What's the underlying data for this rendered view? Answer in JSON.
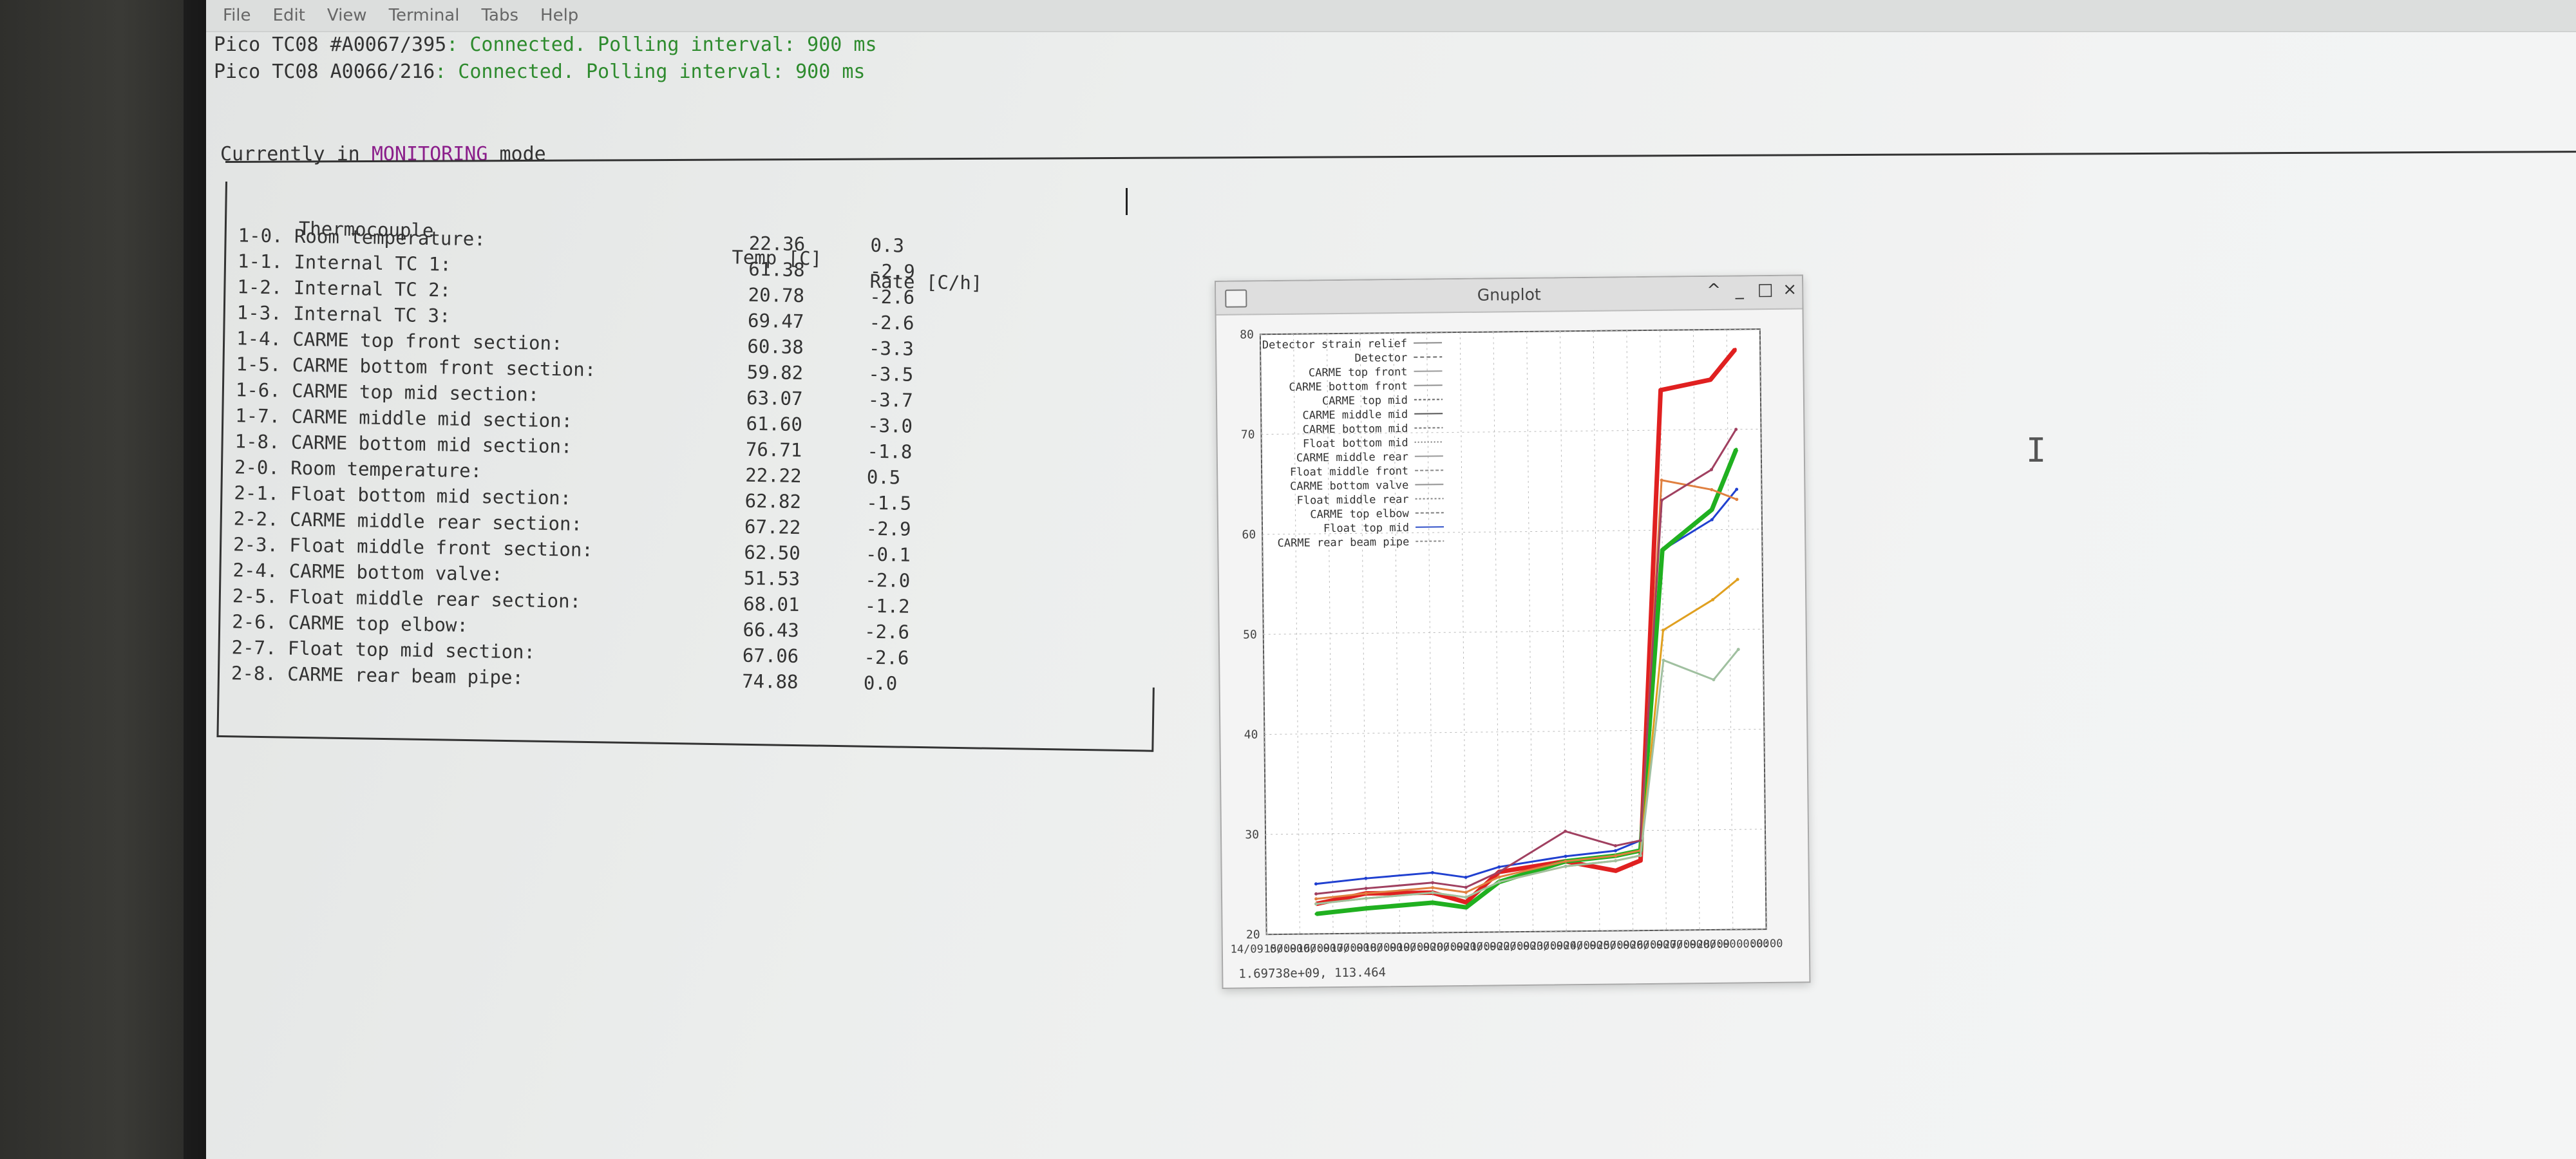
{
  "menubar": {
    "items": [
      "File",
      "Edit",
      "View",
      "Terminal",
      "Tabs",
      "Help"
    ]
  },
  "log": [
    {
      "device": "Pico TC08 #A0067/395",
      "message": ": Connected. Polling interval: 900 ms"
    },
    {
      "device": "Pico TC08 A0066/216",
      "message": ": Connected. Polling interval: 900 ms"
    }
  ],
  "mode": {
    "prefix": "Currently in ",
    "value": "MONITORING",
    "suffix": " mode"
  },
  "table": {
    "headers": {
      "name": "Thermocouple",
      "temp": "Temp [C]",
      "rate": "Rate [C/h]"
    },
    "rows": [
      {
        "name": "1-0. Room temperature:",
        "temp": "22.36",
        "rate": "0.3"
      },
      {
        "name": "1-1. Internal TC 1:",
        "temp": "61.38",
        "rate": "-2.9"
      },
      {
        "name": "1-2. Internal TC 2:",
        "temp": "20.78",
        "rate": "-2.6"
      },
      {
        "name": "1-3. Internal TC 3:",
        "temp": "69.47",
        "rate": "-2.6"
      },
      {
        "name": "1-4. CARME top front section:",
        "temp": "60.38",
        "rate": "-3.3"
      },
      {
        "name": "1-5. CARME bottom front section:",
        "temp": "59.82",
        "rate": "-3.5"
      },
      {
        "name": "1-6. CARME top mid section:",
        "temp": "63.07",
        "rate": "-3.7"
      },
      {
        "name": "1-7. CARME middle mid section:",
        "temp": "61.60",
        "rate": "-3.0"
      },
      {
        "name": "1-8. CARME bottom mid section:",
        "temp": "76.71",
        "rate": "-1.8"
      },
      {
        "name": "2-0. Room temperature:",
        "temp": "22.22",
        "rate": "0.5"
      },
      {
        "name": "2-1. Float bottom mid section:",
        "temp": "62.82",
        "rate": "-1.5"
      },
      {
        "name": "2-2. CARME middle rear section:",
        "temp": "67.22",
        "rate": "-2.9"
      },
      {
        "name": "2-3. Float middle front section:",
        "temp": "62.50",
        "rate": "-0.1"
      },
      {
        "name": "2-4. CARME bottom valve:",
        "temp": "51.53",
        "rate": "-2.0"
      },
      {
        "name": "2-5. Float middle rear section:",
        "temp": "68.01",
        "rate": "-1.2"
      },
      {
        "name": "2-6. CARME top elbow:",
        "temp": "66.43",
        "rate": "-2.6"
      },
      {
        "name": "2-7. Float top mid section:",
        "temp": "67.06",
        "rate": "-2.6"
      },
      {
        "name": "2-8. CARME rear beam pipe:",
        "temp": "74.88",
        "rate": "0.0"
      }
    ]
  },
  "gnuplot": {
    "title": "Gnuplot",
    "controls": {
      "up": "^",
      "minimize": "_",
      "maximize": "□",
      "close": "×"
    },
    "status": "1.69738e+09,  113.464",
    "y_ticks": [
      "20",
      "30",
      "40",
      "50",
      "60",
      "70",
      "80"
    ],
    "x_ticks": [
      "14/09 00:00",
      "15/09 00:00",
      "16/09 00:00",
      "17/09 00:00",
      "18/09 00:00",
      "19/09 00:00",
      "20/09 00:00",
      "21/09 00:00",
      "22/09 00:00",
      "23/09 00:00",
      "24/09 00:00",
      "25/09 00:00",
      "26/09 00:00",
      "27/09 00:00",
      "28/09 00:00",
      "00:00"
    ],
    "legend": [
      {
        "name": "Detector strain relief",
        "color": "#8a8a8a",
        "dash": ""
      },
      {
        "name": "Detector",
        "color": "#6a6a6a",
        "dash": "6,4"
      },
      {
        "name": "CARME top front",
        "color": "#9a9a9a",
        "dash": ""
      },
      {
        "name": "CARME bottom front",
        "color": "#8e8e8e",
        "dash": ""
      },
      {
        "name": "CARME top mid",
        "color": "#666666",
        "dash": "4,3"
      },
      {
        "name": "CARME middle mid",
        "color": "#555555",
        "dash": ""
      },
      {
        "name": "CARME bottom mid",
        "color": "#777777",
        "dash": "4,3"
      },
      {
        "name": "Float bottom mid",
        "color": "#7a7a7a",
        "dash": "2,3"
      },
      {
        "name": "CARME middle rear",
        "color": "#999999",
        "dash": ""
      },
      {
        "name": "Float middle front",
        "color": "#888888",
        "dash": "5,3"
      },
      {
        "name": "CARME bottom valve",
        "color": "#909090",
        "dash": ""
      },
      {
        "name": "Float middle rear",
        "color": "#858585",
        "dash": "3,3"
      },
      {
        "name": "CARME top elbow",
        "color": "#7d7d7d",
        "dash": "5,3"
      },
      {
        "name": "Float top mid",
        "color": "#3050c8",
        "dash": ""
      },
      {
        "name": "CARME rear beam pipe",
        "color": "#8a8a8a",
        "dash": "4,3"
      }
    ]
  },
  "chart_data": {
    "type": "line",
    "ylim": [
      20,
      80
    ],
    "xlim": [
      "14/09 00:00",
      "29/09 00:00"
    ],
    "x_ticks": [
      "14/09 00:00",
      "15/09 00:00",
      "16/09 00:00",
      "17/09 00:00",
      "18/09 00:00",
      "19/09 00:00",
      "20/09 00:00",
      "21/09 00:00",
      "22/09 00:00",
      "23/09 00:00",
      "24/09 00:00",
      "25/09 00:00",
      "26/09 00:00",
      "27/09 00:00",
      "28/09 00:00",
      "29/09 00:00"
    ],
    "grid": true,
    "legend_position": "top-left",
    "series": [
      {
        "name": "CARME rear beam pipe",
        "color": "#e02020",
        "x": [
          "15/09 12:00",
          "17/09 00:00",
          "19/09 00:00",
          "20/09 00:00",
          "21/09 00:00",
          "23/09 00:00",
          "24/09 12:00",
          "25/09 06:00",
          "26/09 00:00",
          "27/09 12:00",
          "28/09 06:00"
        ],
        "values": [
          23,
          24,
          24,
          23,
          26,
          27,
          26,
          27,
          74,
          75,
          78
        ]
      },
      {
        "name": "Float top mid",
        "color": "#2040d0",
        "x": [
          "15/09 12:00",
          "17/09 00:00",
          "19/09 00:00",
          "20/09 00:00",
          "21/09 00:00",
          "23/09 00:00",
          "24/09 12:00",
          "25/09 06:00",
          "26/09 00:00",
          "27/09 12:00",
          "28/09 06:00"
        ],
        "values": [
          25,
          25.5,
          26,
          25.5,
          26.5,
          27.5,
          28,
          29,
          58,
          61,
          64
        ]
      },
      {
        "name": "CARME top elbow",
        "color": "#20b020",
        "x": [
          "15/09 12:00",
          "17/09 00:00",
          "19/09 00:00",
          "20/09 00:00",
          "21/09 00:00",
          "23/09 00:00",
          "24/09 12:00",
          "25/09 06:00",
          "26/09 00:00",
          "27/09 12:00",
          "28/09 06:00"
        ],
        "values": [
          22,
          22.5,
          23,
          22.5,
          25,
          27,
          27.5,
          28,
          58,
          62,
          68
        ]
      },
      {
        "name": "Float middle rear",
        "color": "#e08040",
        "x": [
          "15/09 12:00",
          "17/09 00:00",
          "19/09 00:00",
          "20/09 00:00",
          "21/09 00:00",
          "23/09 00:00",
          "24/09 12:00",
          "25/09 06:00",
          "26/09 00:00",
          "27/09 12:00",
          "28/09 06:00"
        ],
        "values": [
          23.5,
          24,
          24.5,
          24,
          25.5,
          27,
          27.5,
          28,
          65,
          64,
          63
        ]
      },
      {
        "name": "CARME bottom valve",
        "color": "#e0a020",
        "x": [
          "15/09 12:00",
          "17/09 00:00",
          "19/09 00:00",
          "20/09 00:00",
          "21/09 00:00",
          "23/09 00:00",
          "24/09 12:00",
          "25/09 06:00",
          "26/09 00:00",
          "27/09 12:00",
          "28/09 06:00"
        ],
        "values": [
          23,
          23.5,
          24,
          23.5,
          25,
          26.5,
          27,
          27.5,
          50,
          53,
          55
        ]
      },
      {
        "name": "Float middle front",
        "color": "#a0c0a0",
        "x": [
          "15/09 12:00",
          "17/09 00:00",
          "19/09 00:00",
          "20/09 00:00",
          "21/09 00:00",
          "23/09 00:00",
          "24/09 12:00",
          "25/09 06:00",
          "26/09 00:00",
          "27/09 12:00",
          "28/09 06:00"
        ],
        "values": [
          23,
          23.5,
          24,
          23.5,
          25,
          26.5,
          27,
          27.5,
          47,
          45,
          48
        ]
      },
      {
        "name": "Detector",
        "color": "#a04060",
        "x": [
          "15/09 12:00",
          "17/09 00:00",
          "19/09 00:00",
          "20/09 00:00",
          "21/09 00:00",
          "23/09 00:00",
          "24/09 12:00",
          "25/09 06:00",
          "26/09 00:00",
          "27/09 12:00",
          "28/09 06:00"
        ],
        "values": [
          24,
          24.5,
          25,
          24.5,
          26,
          30,
          28.5,
          29,
          63,
          66,
          70
        ]
      }
    ]
  }
}
